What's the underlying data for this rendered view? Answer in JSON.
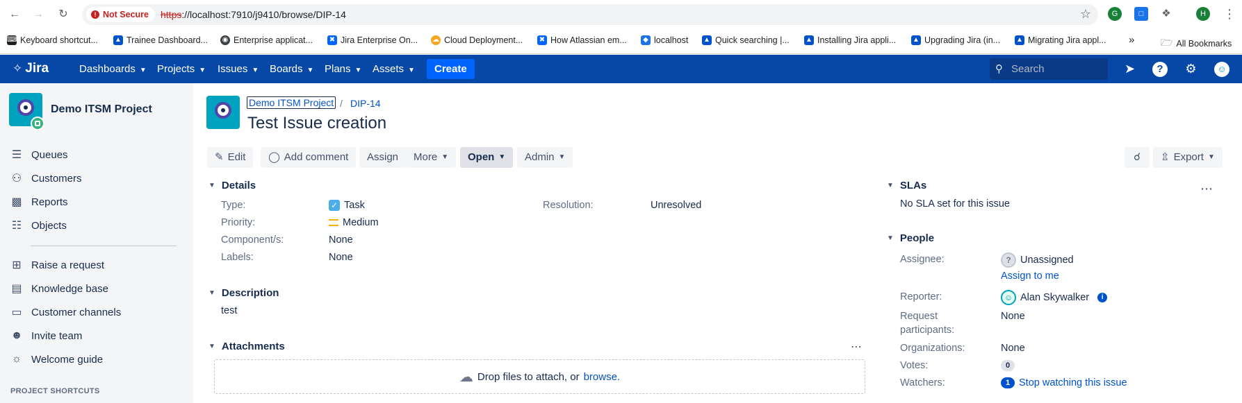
{
  "browser": {
    "security_label": "Not Secure",
    "url_protocol": "https",
    "url_rest": "://localhost:7910/j9410/browse/DIP-14",
    "profile_initial": "H",
    "bookmarks": [
      "Keyboard shortcut...",
      "Trainee Dashboard...",
      "Enterprise applicat...",
      "Jira Enterprise On...",
      "Cloud Deployment...",
      "How Atlassian em...",
      "localhost",
      "Quick searching |...",
      "Installing Jira appli...",
      "Upgrading Jira (in...",
      "Migrating Jira appl..."
    ],
    "more_bookmarks": "»",
    "all_bookmarks": "All Bookmarks"
  },
  "header": {
    "logo": "Jira",
    "menus": [
      "Dashboards",
      "Projects",
      "Issues",
      "Boards",
      "Plans",
      "Assets"
    ],
    "create_label": "Create",
    "search_placeholder": "Search"
  },
  "sidebar": {
    "project_name": "Demo ITSM Project",
    "items_top": [
      "Queues",
      "Customers",
      "Reports",
      "Objects"
    ],
    "items_bottom": [
      "Raise a request",
      "Knowledge base",
      "Customer channels",
      "Invite team",
      "Welcome guide"
    ],
    "shortcuts_heading": "PROJECT SHORTCUTS"
  },
  "issue": {
    "project_link": "Demo ITSM Project",
    "separator": "/",
    "key": "DIP-14",
    "title": "Test Issue creation",
    "toolbar": {
      "edit": "Edit",
      "add_comment": "Add comment",
      "assign": "Assign",
      "more": "More",
      "status": "Open",
      "admin": "Admin",
      "export": "Export"
    },
    "details": {
      "heading": "Details",
      "type_label": "Type:",
      "type_value": "Task",
      "priority_label": "Priority:",
      "priority_value": "Medium",
      "components_label": "Component/s:",
      "components_value": "None",
      "labels_label": "Labels:",
      "labels_value": "None",
      "resolution_label": "Resolution:",
      "resolution_value": "Unresolved"
    },
    "description": {
      "heading": "Description",
      "text": "test"
    },
    "attachments": {
      "heading": "Attachments",
      "drop_text": "Drop files to attach, or",
      "browse_link": "browse."
    }
  },
  "right_panel": {
    "slas_heading": "SLAs",
    "slas_text": "No SLA set for this issue",
    "people_heading": "People",
    "assignee_label": "Assignee:",
    "assignee_value": "Unassigned",
    "assign_to_me": "Assign to me",
    "reporter_label": "Reporter:",
    "reporter_value": "Alan Skywalker",
    "participants_label_1": "Request",
    "participants_label_2": "participants:",
    "participants_value": "None",
    "organizations_label": "Organizations:",
    "organizations_value": "None",
    "votes_label": "Votes:",
    "votes_count": "0",
    "watchers_label": "Watchers:",
    "watchers_count": "1",
    "watch_link": "Stop watching this issue"
  },
  "colors": {
    "jira_nav": "#0747a6",
    "create_button": "#0065ff",
    "link": "#0052cc",
    "not_secure": "#c5221f"
  }
}
